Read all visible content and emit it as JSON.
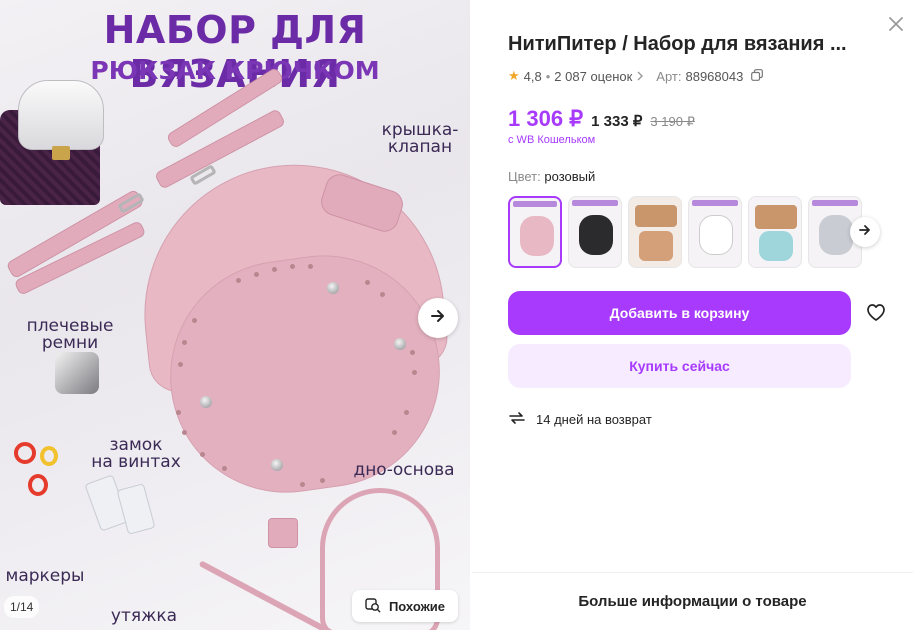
{
  "gallery": {
    "banner_title": "НАБОР ДЛЯ ВЯЗАНИЯ",
    "banner_subtitle": "РЮКЗАК КРЮЧКОМ",
    "callouts": {
      "lid": "крышка-\nклапан",
      "straps": "плечевые\nремни",
      "lock": "замок\nна винтах",
      "bottom": "дно-основа",
      "markers": "маркеры",
      "drawstring": "утяжка"
    },
    "counter": "1/14",
    "similar_label": "Похожие"
  },
  "product": {
    "title": "НитиПитер / Набор для вязания ...",
    "rating": "4,8",
    "reviews": "2 087 оценок",
    "article_label": "Арт:",
    "article": "88968043",
    "price_wallet": "1 306 ₽",
    "price_regular": "1 333 ₽",
    "price_old": "3 190 ₽",
    "wallet_note": "с WB Кошельком",
    "color_label": "Цвет:",
    "color_value": "розовый",
    "add_to_cart": "Добавить в корзину",
    "buy_now": "Купить сейчас",
    "return_policy": "14 дней на возврат",
    "more_info": "Больше информации о товаре"
  },
  "colors": {
    "accent": "#a73afd",
    "accent_light": "#f6ebff",
    "banner_purple": "#6b2aa6",
    "product_pink": "#e8b9c5"
  },
  "icons": [
    "close-icon",
    "star-icon",
    "chevron-right-icon",
    "copy-icon",
    "arrow-right-icon",
    "heart-icon",
    "return-icon",
    "similar-search-icon"
  ]
}
